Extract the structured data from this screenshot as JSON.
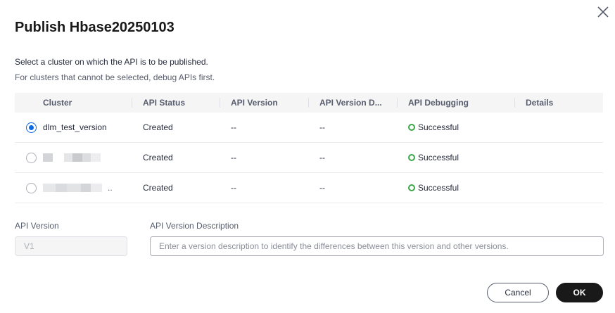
{
  "dialog": {
    "title": "Publish Hbase20250103",
    "description_line1": "Select a cluster on which the API is to be published.",
    "description_line2": "For clusters that cannot be selected, debug APIs first."
  },
  "table": {
    "columns": [
      "Cluster",
      "API Status",
      "API Version",
      "API Version D...",
      "API Debugging",
      "Details"
    ],
    "rows": [
      {
        "cluster": "dlm_test_version",
        "selected": true,
        "status": "Created",
        "version": "--",
        "version_desc": "--",
        "debugging": "Successful",
        "details": ""
      },
      {
        "cluster": "",
        "selected": false,
        "status": "Created",
        "version": "--",
        "version_desc": "--",
        "debugging": "Successful",
        "details": ""
      },
      {
        "cluster": "",
        "selected": false,
        "status": "Created",
        "version": "--",
        "version_desc": "--",
        "debugging": "Successful",
        "details": ""
      }
    ],
    "row3_ellipsis": ".."
  },
  "form": {
    "version_label": "API Version",
    "version_value": "V1",
    "description_label": "API Version Description",
    "description_placeholder": "Enter a version description to identify the differences between this version and other versions."
  },
  "footer": {
    "cancel_label": "Cancel",
    "ok_label": "OK"
  },
  "colors": {
    "accent": "#0d69e1",
    "success": "#3ba64a",
    "primary_button": "#191919"
  },
  "icons": {
    "close": "close-icon",
    "success": "success-circle-icon"
  }
}
